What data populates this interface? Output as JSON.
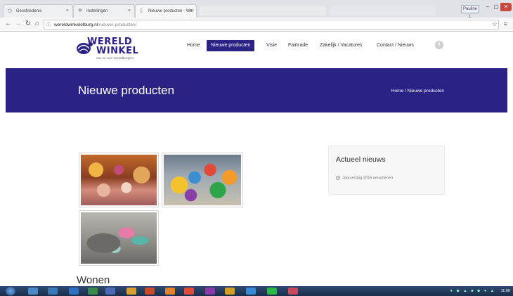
{
  "browser": {
    "tabs": [
      {
        "label": "Geschiedenis",
        "icon": "history-icon",
        "active": false
      },
      {
        "label": "Instellingen",
        "icon": "gear-icon",
        "active": false
      },
      {
        "label": "Nieuwe producten - Wer",
        "icon": "page-icon",
        "active": true
      }
    ],
    "profile_label": "Pauline L",
    "url_domain": "wereldwinkelelburg.nl",
    "url_path": "/nieuwe-producten/"
  },
  "site": {
    "logo_line1": "WERELD",
    "logo_line2": "WINKEL",
    "logo_tagline": "van en voor wereldburgers",
    "nav": [
      {
        "label": "Home",
        "active": false
      },
      {
        "label": "Nieuwe producten",
        "active": true
      },
      {
        "label": "Visie",
        "active": false
      },
      {
        "label": "Fairtrade",
        "active": false
      },
      {
        "label": "Zakelijk / Vacatures",
        "active": false
      },
      {
        "label": "Contact / Nieuws",
        "active": false
      }
    ],
    "social_icon": "facebook-icon",
    "social_glyph": "f"
  },
  "banner": {
    "title": "Nieuwe producten",
    "breadcrumb": "Home  /  Nieuwe producten"
  },
  "content": {
    "section_heading": "Wonen"
  },
  "sidebar": {
    "widget_title": "Actueel nieuws",
    "items": [
      "Jaarverslag 2015 verschenen"
    ]
  },
  "taskbar": {
    "time": "11:00"
  },
  "colors": {
    "brand": "#2b2286"
  }
}
